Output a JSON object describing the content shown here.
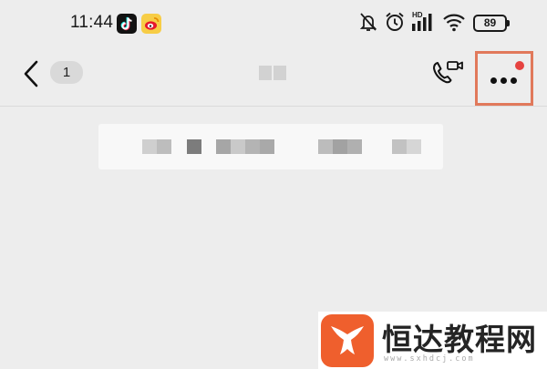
{
  "status_bar": {
    "time": "11:44",
    "battery": "89",
    "network_badge": "HD",
    "icons": [
      "tiktok-icon",
      "weibo-icon",
      "mute-icon",
      "alarm-icon",
      "signal-icon",
      "wifi-icon",
      "battery-icon"
    ]
  },
  "nav": {
    "unread_count": "1",
    "icons": [
      "back-arrow-icon",
      "video-call-icon",
      "more-dots-icon"
    ],
    "highlight_color": "#e1795b",
    "notification_dot_color": "#e64340"
  },
  "watermark": {
    "name": "恒达教程网",
    "url": "www.sxhdcj.com",
    "brand_color": "#ef5f2d"
  }
}
